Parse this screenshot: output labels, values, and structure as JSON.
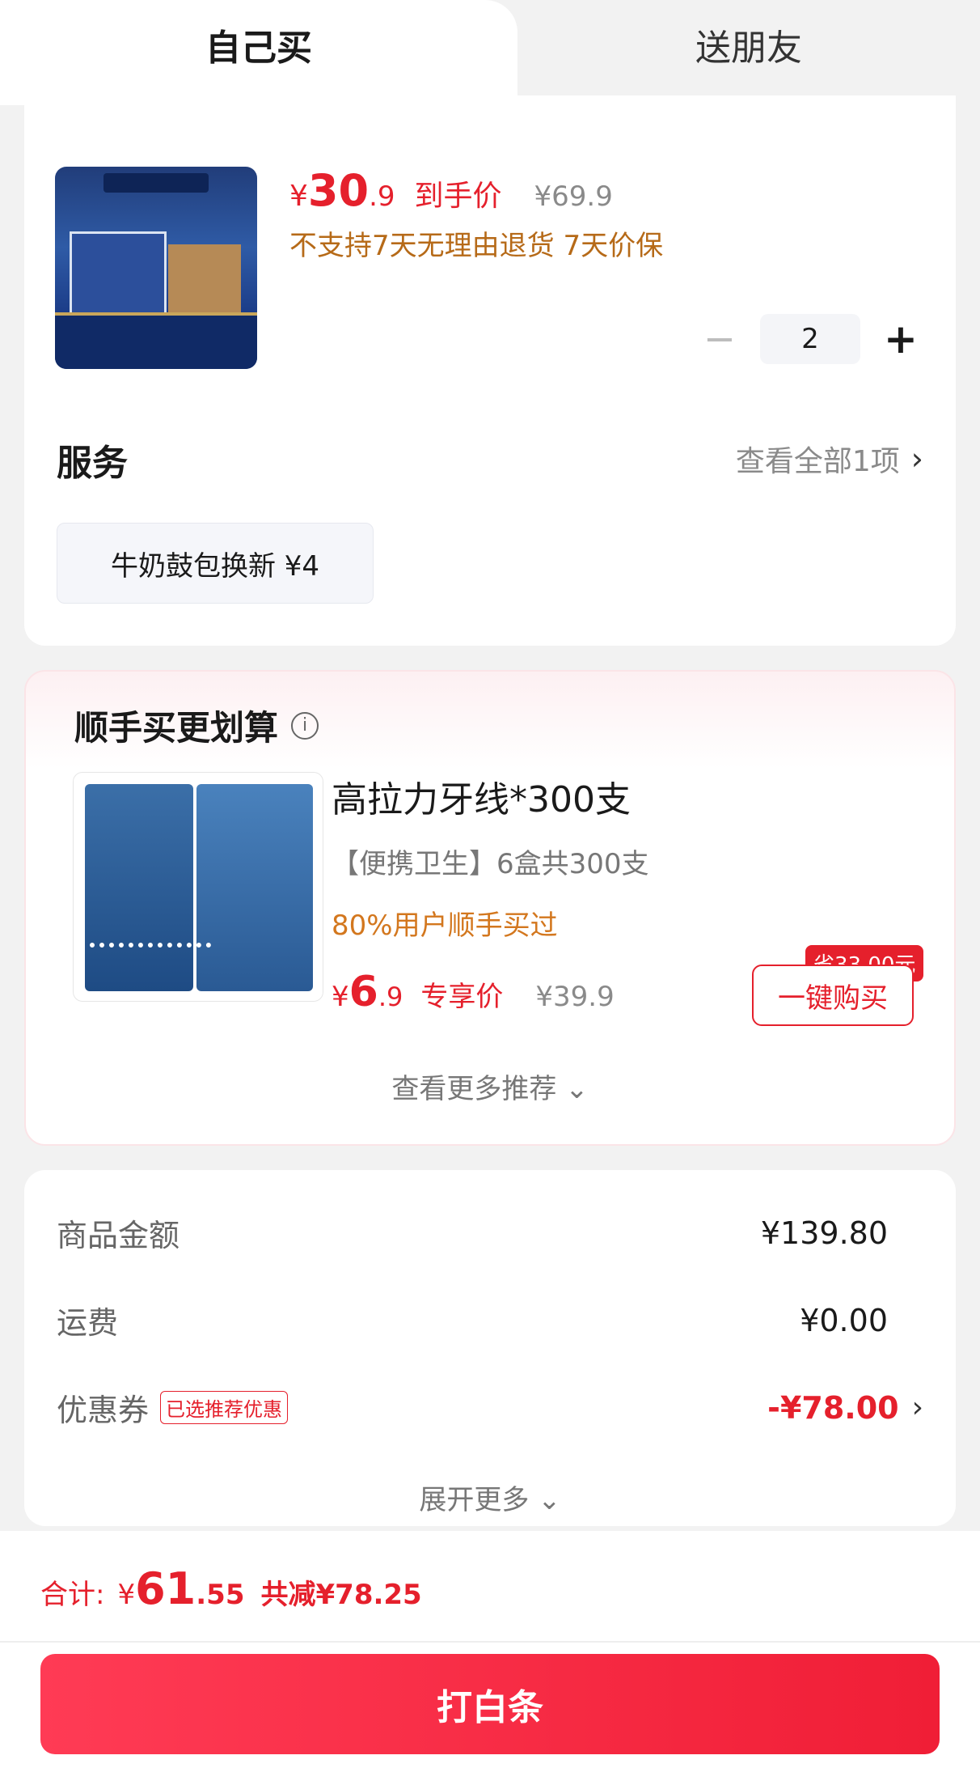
{
  "tabs": {
    "self": "自己买",
    "friend": "送朋友"
  },
  "product": {
    "price_symbol": "¥",
    "price_int": "30",
    "price_dec": ".9",
    "price_tag": "到手价",
    "original_price": "¥69.9",
    "policy": "不支持7天无理由退货 7天价保",
    "quantity": "2",
    "minus": "−",
    "plus": "+"
  },
  "service": {
    "title": "服务",
    "view_all": "查看全部1项",
    "chip": "牛奶鼓包换新 ¥4"
  },
  "upsell": {
    "title": "顺手买更划算",
    "info": "i",
    "name": "高拉力牙线*300支",
    "subtitle": "【便携卫生】6盒共300支",
    "percent_text": "80%用户顺手买过",
    "price_symbol": "¥",
    "price_int": "6",
    "price_dec": ".9",
    "price_tag": "专享价",
    "original_price": "¥39.9",
    "save_badge": "省33.00元",
    "buy_button": "一键购买",
    "more": "查看更多推荐 ⌄"
  },
  "summary": {
    "goods_label": "商品金额",
    "goods_value": "¥139.80",
    "shipping_label": "运费",
    "shipping_value": "¥0.00",
    "coupon_label": "优惠券",
    "coupon_tag": "已选推荐优惠",
    "coupon_value": "-¥78.00",
    "expand": "展开更多 ⌄"
  },
  "footer": {
    "total_label": "合计:",
    "total_symbol": "¥",
    "total_int": "61",
    "total_dec": ".55",
    "total_save": "共减¥78.25",
    "pay_button": "打白条"
  },
  "colors": {
    "accent": "#e5202c",
    "policy": "#b66a18",
    "percent": "#d3771e"
  }
}
